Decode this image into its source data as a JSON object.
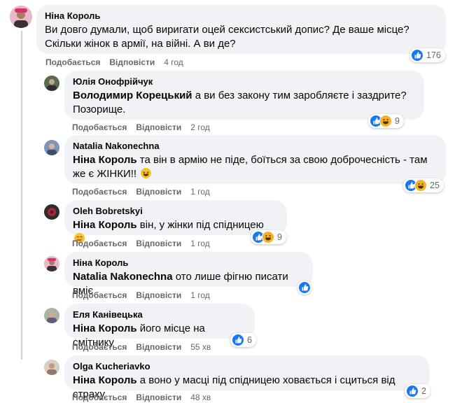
{
  "labels": {
    "like": "Подобається",
    "reply": "Відповісти"
  },
  "comments": [
    {
      "author": "Ніна Король",
      "mention": "",
      "text_lines": [
        "Ви довго думали, щоб виригати оцей сексистський допис? Де ваше місце?",
        "Скільки жінок в армії, на війні. А ви де?"
      ],
      "time": "4 год",
      "reactions": {
        "types": [
          "like"
        ],
        "count": "176"
      }
    },
    {
      "author": "Юлія Онофрійчук",
      "mention": "Володимир Корецький",
      "text_lines": [
        "а ви без закону тим заробляєте і заздрите?",
        "Позорище."
      ],
      "time": "2 год",
      "reactions": {
        "types": [
          "like",
          "haha"
        ],
        "count": "9"
      }
    },
    {
      "author": "Natalia Nakonechna",
      "mention": "Ніна Король",
      "text_lines": [
        "та він в армію не піде, боїться за свою доброчесність - там",
        "же є ЖІНКИ!!"
      ],
      "time": "1 год",
      "reactions": {
        "types": [
          "like",
          "haha"
        ],
        "count": "25"
      },
      "emoji": "laughing-emoji"
    },
    {
      "author": "Oleh Bobretskyi",
      "mention": "Ніна Король",
      "text_lines": [
        "він, у жінки під спідницею"
      ],
      "time": "1 год",
      "reactions": {
        "types": [
          "like",
          "haha"
        ],
        "count": "9"
      },
      "emoji": "smiling-emoji"
    },
    {
      "author": "Ніна Король",
      "mention": "Natalia Nakonechna",
      "text_lines": [
        "ото лише фігню писати вміє"
      ],
      "time": "1 год",
      "reactions": {
        "types": [
          "like"
        ],
        "count": ""
      }
    },
    {
      "author": "Еля Канівецька",
      "mention": "Ніна Король",
      "text_lines": [
        "його місце на смітнику"
      ],
      "time": "55 хв",
      "reactions": {
        "types": [
          "like"
        ],
        "count": "6"
      }
    },
    {
      "author": "Olga Kucheriavko",
      "mention": "Ніна Король",
      "text_lines": [
        "а воно у масці під спідницею ховається і сциться від страху"
      ],
      "time": "48 хв",
      "reactions": {
        "types": [
          "like"
        ],
        "count": "2"
      }
    }
  ],
  "colors": {
    "bubble": "#f0f2f5",
    "like": "#1877f2",
    "haha": "#f7b125",
    "meta": "#65676b"
  }
}
